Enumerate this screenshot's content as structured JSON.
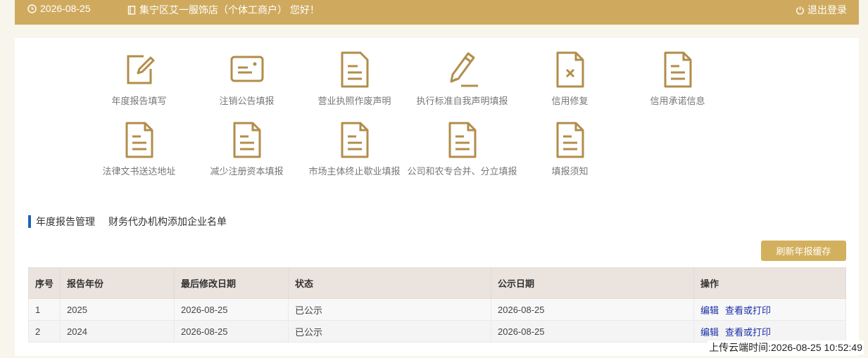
{
  "header": {
    "date": "2026-08-25",
    "greeting": "集宁区艾一服饰店（个体工商户） 您好！",
    "logout_label": "退出登录",
    "bg_color": "#cfaa5e"
  },
  "menu": {
    "row1": [
      {
        "label": "年度报告填写",
        "icon": "edit-icon"
      },
      {
        "label": "注销公告填报",
        "icon": "card-icon"
      },
      {
        "label": "营业执照作废声明",
        "icon": "document-icon"
      },
      {
        "label": "执行标准自我声明填报",
        "icon": "pencil-icon"
      },
      {
        "label": "信用修复",
        "icon": "document-x-icon"
      },
      {
        "label": "信用承诺信息",
        "icon": "document-icon"
      }
    ],
    "row2": [
      {
        "label": "法律文书送达地址",
        "icon": "document-icon"
      },
      {
        "label": "减少注册资本填报",
        "icon": "document-icon"
      },
      {
        "label": "市场主体终止歇业填报",
        "icon": "document-icon"
      },
      {
        "label": "公司和农专合并、分立填报",
        "icon": "document-icon"
      },
      {
        "label": "填报须知",
        "icon": "document-icon"
      }
    ],
    "icon_color": "#b28d4a"
  },
  "tabs": [
    "年度报告管理",
    "财务代办机构添加企业名单"
  ],
  "refresh_label": "刷新年报缓存",
  "table": {
    "columns": [
      "序号",
      "报告年份",
      "最后修改日期",
      "状态",
      "公示日期",
      "操作"
    ],
    "rows": [
      {
        "no": "1",
        "year": "2025",
        "modified": "2026-08-25",
        "status": "已公示",
        "publish": "2026-08-25",
        "edit": "编辑",
        "view": "查看或打印"
      },
      {
        "no": "2",
        "year": "2024",
        "modified": "2026-08-25",
        "status": "已公示",
        "publish": "2026-08-25",
        "edit": "编辑",
        "view": "查看或打印"
      }
    ]
  },
  "upload_time": "上传云端时间:2026-08-25 10:52:49"
}
